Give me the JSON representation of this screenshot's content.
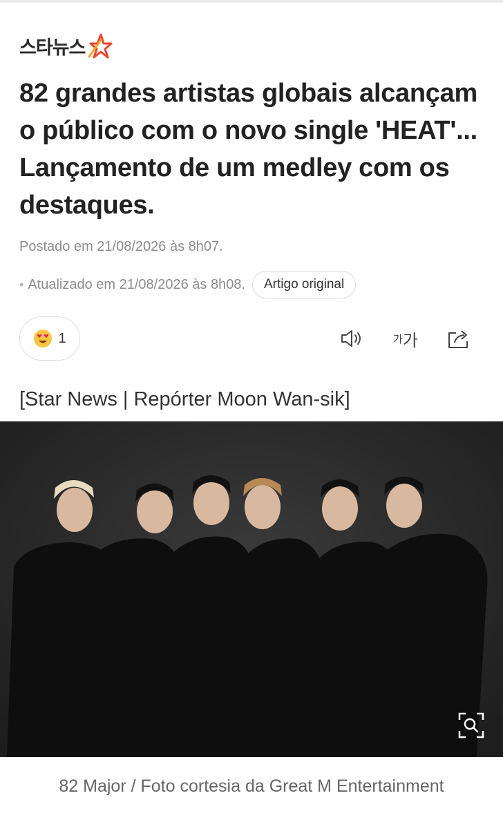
{
  "brand": {
    "name": "스타뉴스",
    "accent": "#e8452c"
  },
  "article": {
    "headline": "82 grandes artistas globais alcançam o público com o novo single 'HEAT'... Lançamento de um medley com os destaques.",
    "posted": "Postado em  21/08/2026 às 8h07.",
    "updated": "Atualizado  em 21/08/2026 às 8h08.",
    "original_label": "Artigo original",
    "byline": "[Star News | Repórter Moon Wan-sik]",
    "caption": "82 Major / Foto cortesia da Great M Entertainment"
  },
  "reaction": {
    "icon": "heart-eyes-emoji-icon",
    "count": "1"
  },
  "toolbar": {
    "sound_icon": "speaker-icon",
    "font_small": "가",
    "font_big": "가",
    "share_icon": "share-icon"
  },
  "photo": {
    "icon": "zoom-scan-icon",
    "background": "#2e2e2e"
  }
}
